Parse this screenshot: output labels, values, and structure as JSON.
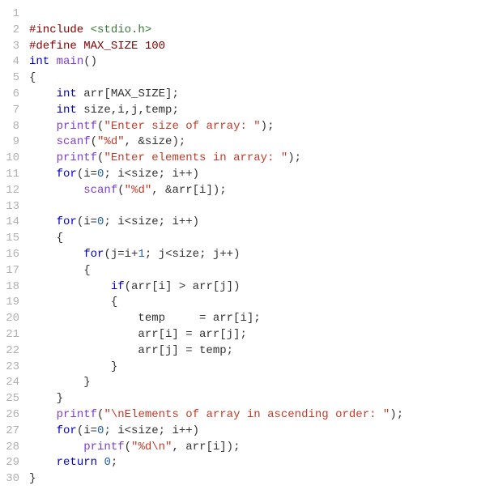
{
  "code": {
    "lines": [
      {
        "num": "1",
        "tokens": []
      },
      {
        "num": "2",
        "tokens": [
          {
            "cls": "tok-preproc",
            "text": "#include "
          },
          {
            "cls": "tok-include",
            "text": "<stdio.h>"
          }
        ]
      },
      {
        "num": "3",
        "tokens": [
          {
            "cls": "tok-preproc",
            "text": "#define MAX_SIZE 100"
          }
        ]
      },
      {
        "num": "4",
        "tokens": [
          {
            "cls": "tok-type",
            "text": "int"
          },
          {
            "cls": "tok-plain",
            "text": " "
          },
          {
            "cls": "tok-func",
            "text": "main"
          },
          {
            "cls": "tok-plain",
            "text": "()"
          }
        ]
      },
      {
        "num": "5",
        "tokens": [
          {
            "cls": "tok-plain",
            "text": "{"
          }
        ]
      },
      {
        "num": "6",
        "tokens": [
          {
            "cls": "tok-plain",
            "text": "    "
          },
          {
            "cls": "tok-type",
            "text": "int"
          },
          {
            "cls": "tok-plain",
            "text": " arr[MAX_SIZE];"
          }
        ]
      },
      {
        "num": "7",
        "tokens": [
          {
            "cls": "tok-plain",
            "text": "    "
          },
          {
            "cls": "tok-type",
            "text": "int"
          },
          {
            "cls": "tok-plain",
            "text": " size,i,j,temp;"
          }
        ]
      },
      {
        "num": "8",
        "tokens": [
          {
            "cls": "tok-plain",
            "text": "    "
          },
          {
            "cls": "tok-func",
            "text": "printf"
          },
          {
            "cls": "tok-plain",
            "text": "("
          },
          {
            "cls": "tok-string",
            "text": "\"Enter size of array: \""
          },
          {
            "cls": "tok-plain",
            "text": ");"
          }
        ]
      },
      {
        "num": "9",
        "tokens": [
          {
            "cls": "tok-plain",
            "text": "    "
          },
          {
            "cls": "tok-func",
            "text": "scanf"
          },
          {
            "cls": "tok-plain",
            "text": "("
          },
          {
            "cls": "tok-string",
            "text": "\"%d\""
          },
          {
            "cls": "tok-plain",
            "text": ", &size);"
          }
        ]
      },
      {
        "num": "10",
        "tokens": [
          {
            "cls": "tok-plain",
            "text": "    "
          },
          {
            "cls": "tok-func",
            "text": "printf"
          },
          {
            "cls": "tok-plain",
            "text": "("
          },
          {
            "cls": "tok-string",
            "text": "\"Enter elements in array: \""
          },
          {
            "cls": "tok-plain",
            "text": ");"
          }
        ]
      },
      {
        "num": "11",
        "tokens": [
          {
            "cls": "tok-plain",
            "text": "    "
          },
          {
            "cls": "tok-keyword",
            "text": "for"
          },
          {
            "cls": "tok-plain",
            "text": "(i="
          },
          {
            "cls": "tok-number",
            "text": "0"
          },
          {
            "cls": "tok-plain",
            "text": "; i<size; i++)"
          }
        ]
      },
      {
        "num": "12",
        "tokens": [
          {
            "cls": "tok-plain",
            "text": "        "
          },
          {
            "cls": "tok-func",
            "text": "scanf"
          },
          {
            "cls": "tok-plain",
            "text": "("
          },
          {
            "cls": "tok-string",
            "text": "\"%d\""
          },
          {
            "cls": "tok-plain",
            "text": ", &arr[i]);"
          }
        ]
      },
      {
        "num": "13",
        "tokens": []
      },
      {
        "num": "14",
        "tokens": [
          {
            "cls": "tok-plain",
            "text": "    "
          },
          {
            "cls": "tok-keyword",
            "text": "for"
          },
          {
            "cls": "tok-plain",
            "text": "(i="
          },
          {
            "cls": "tok-number",
            "text": "0"
          },
          {
            "cls": "tok-plain",
            "text": "; i<size; i++)"
          }
        ]
      },
      {
        "num": "15",
        "tokens": [
          {
            "cls": "tok-plain",
            "text": "    {"
          }
        ]
      },
      {
        "num": "16",
        "tokens": [
          {
            "cls": "tok-plain",
            "text": "        "
          },
          {
            "cls": "tok-keyword",
            "text": "for"
          },
          {
            "cls": "tok-plain",
            "text": "(j=i+"
          },
          {
            "cls": "tok-number",
            "text": "1"
          },
          {
            "cls": "tok-plain",
            "text": "; j<size; j++)"
          }
        ]
      },
      {
        "num": "17",
        "tokens": [
          {
            "cls": "tok-plain",
            "text": "        {"
          }
        ]
      },
      {
        "num": "18",
        "tokens": [
          {
            "cls": "tok-plain",
            "text": "            "
          },
          {
            "cls": "tok-keyword",
            "text": "if"
          },
          {
            "cls": "tok-plain",
            "text": "(arr[i] > arr[j])"
          }
        ]
      },
      {
        "num": "19",
        "tokens": [
          {
            "cls": "tok-plain",
            "text": "            {"
          }
        ]
      },
      {
        "num": "20",
        "tokens": [
          {
            "cls": "tok-plain",
            "text": "                temp     = arr[i];"
          }
        ]
      },
      {
        "num": "21",
        "tokens": [
          {
            "cls": "tok-plain",
            "text": "                arr[i] = arr[j];"
          }
        ]
      },
      {
        "num": "22",
        "tokens": [
          {
            "cls": "tok-plain",
            "text": "                arr[j] = temp;"
          }
        ]
      },
      {
        "num": "23",
        "tokens": [
          {
            "cls": "tok-plain",
            "text": "            }"
          }
        ]
      },
      {
        "num": "24",
        "tokens": [
          {
            "cls": "tok-plain",
            "text": "        }"
          }
        ]
      },
      {
        "num": "25",
        "tokens": [
          {
            "cls": "tok-plain",
            "text": "    }"
          }
        ]
      },
      {
        "num": "26",
        "tokens": [
          {
            "cls": "tok-plain",
            "text": "    "
          },
          {
            "cls": "tok-func",
            "text": "printf"
          },
          {
            "cls": "tok-plain",
            "text": "("
          },
          {
            "cls": "tok-string",
            "text": "\"\\nElements of array in ascending order: \""
          },
          {
            "cls": "tok-plain",
            "text": ");"
          }
        ]
      },
      {
        "num": "27",
        "tokens": [
          {
            "cls": "tok-plain",
            "text": "    "
          },
          {
            "cls": "tok-keyword",
            "text": "for"
          },
          {
            "cls": "tok-plain",
            "text": "(i="
          },
          {
            "cls": "tok-number",
            "text": "0"
          },
          {
            "cls": "tok-plain",
            "text": "; i<size; i++)"
          }
        ]
      },
      {
        "num": "28",
        "tokens": [
          {
            "cls": "tok-plain",
            "text": "        "
          },
          {
            "cls": "tok-func",
            "text": "printf"
          },
          {
            "cls": "tok-plain",
            "text": "("
          },
          {
            "cls": "tok-string",
            "text": "\"%d\\n\""
          },
          {
            "cls": "tok-plain",
            "text": ", arr[i]);"
          }
        ]
      },
      {
        "num": "29",
        "tokens": [
          {
            "cls": "tok-plain",
            "text": "    "
          },
          {
            "cls": "tok-keyword",
            "text": "return"
          },
          {
            "cls": "tok-plain",
            "text": " "
          },
          {
            "cls": "tok-number",
            "text": "0"
          },
          {
            "cls": "tok-plain",
            "text": ";"
          }
        ]
      },
      {
        "num": "30",
        "tokens": [
          {
            "cls": "tok-plain",
            "text": "}"
          }
        ]
      }
    ]
  }
}
